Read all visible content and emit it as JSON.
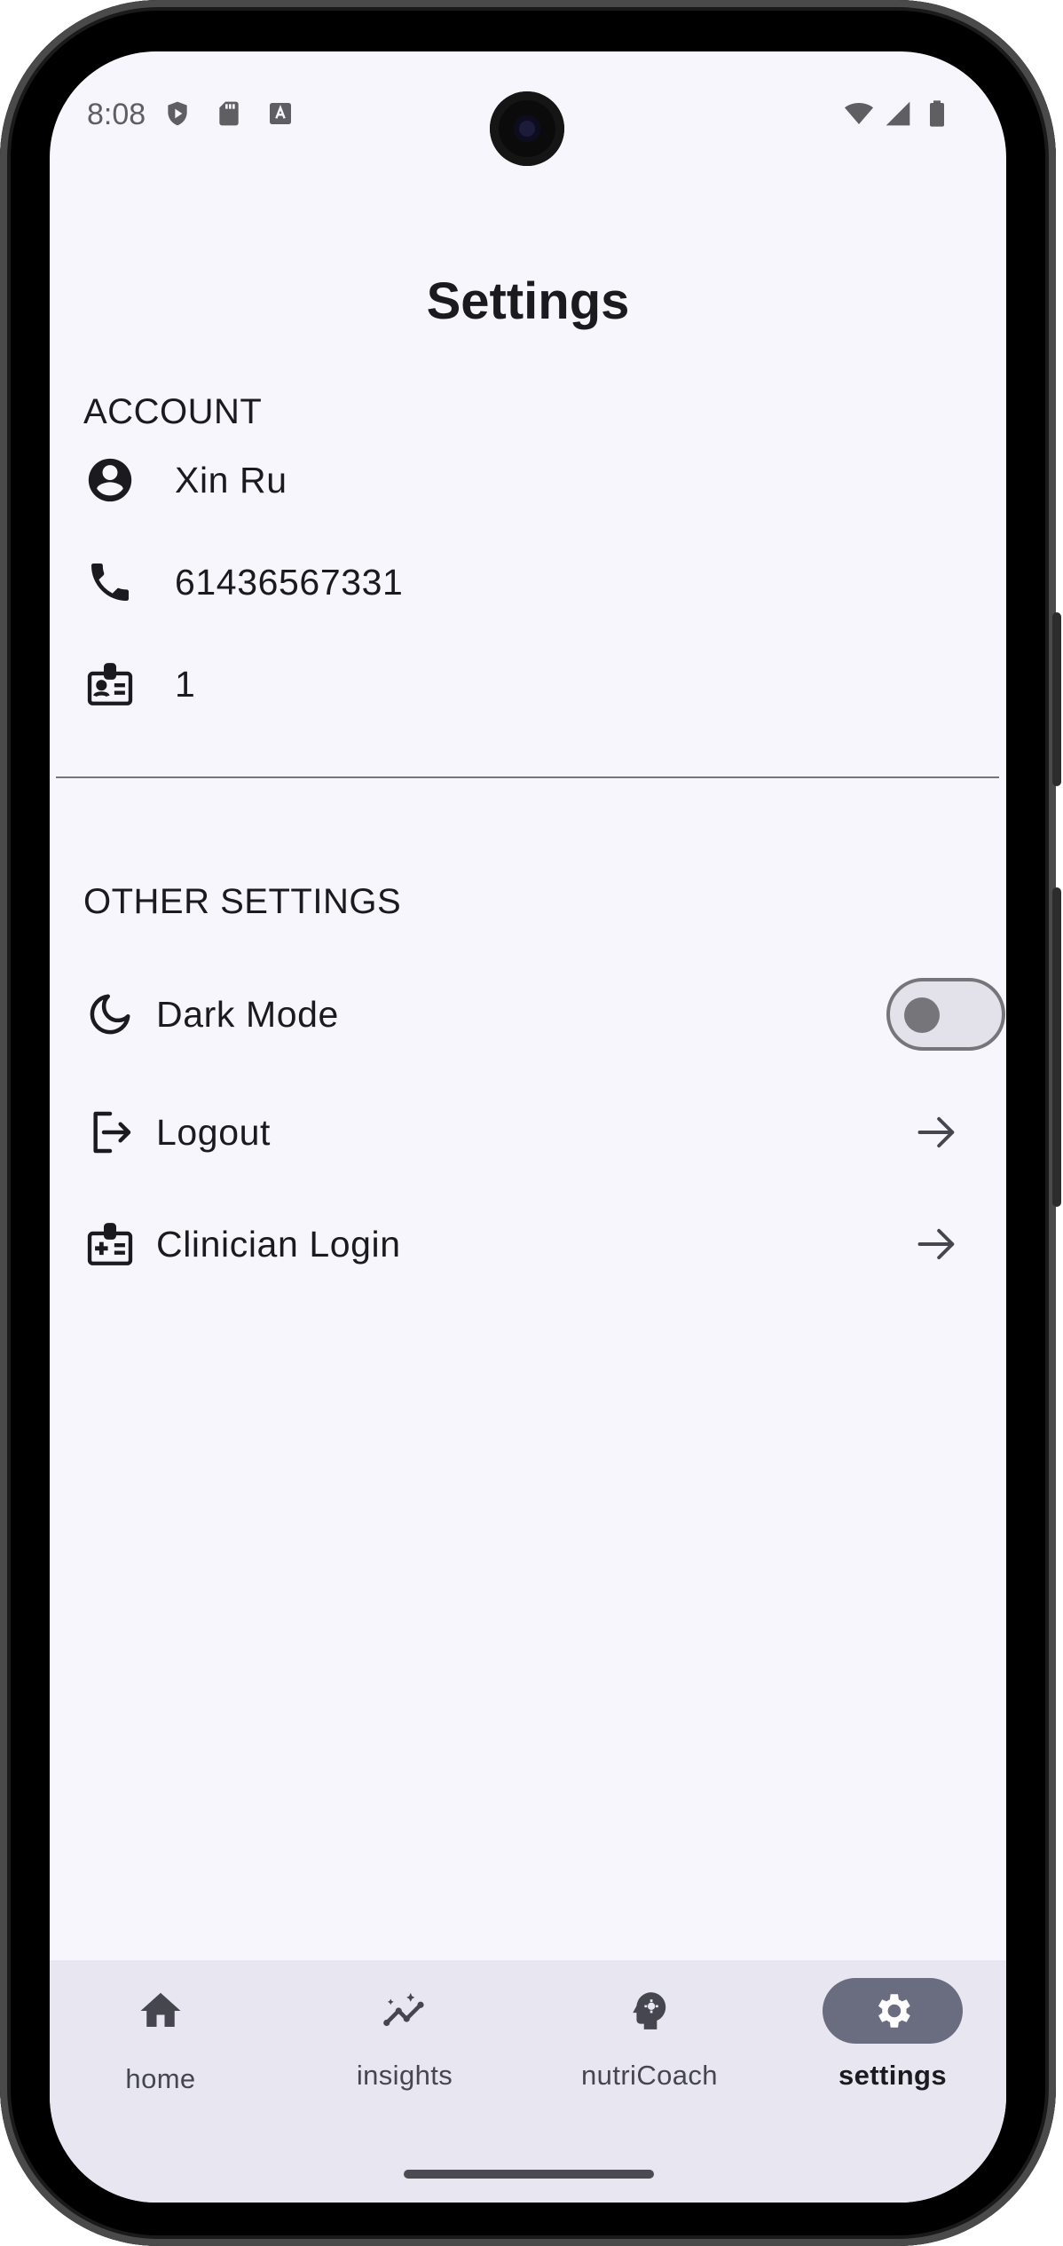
{
  "status_bar": {
    "time": "8:08",
    "left_icons": [
      "play-protect-icon",
      "sd-card-icon",
      "auto-text-icon"
    ],
    "right_icons": [
      "wifi-icon",
      "signal-icon",
      "battery-icon"
    ]
  },
  "header": {
    "title": "Settings"
  },
  "account": {
    "section_title": "ACCOUNT",
    "items": [
      {
        "icon": "account-circle-icon",
        "label": "Xin Ru"
      },
      {
        "icon": "phone-icon",
        "label": "61436567331"
      },
      {
        "icon": "id-badge-icon",
        "label": "1"
      }
    ]
  },
  "other_settings": {
    "section_title": "OTHER SETTINGS",
    "dark_mode": {
      "icon": "moon-icon",
      "label": "Dark Mode",
      "enabled": false
    },
    "logout": {
      "icon": "logout-icon",
      "label": "Logout"
    },
    "clinician_login": {
      "icon": "clinician-badge-icon",
      "label": "Clinician Login"
    }
  },
  "bottom_nav": {
    "items": [
      {
        "icon": "home-icon",
        "label": "home",
        "active": false
      },
      {
        "icon": "insights-icon",
        "label": "insights",
        "active": false
      },
      {
        "icon": "coach-head-icon",
        "label": "nutriCoach",
        "active": false
      },
      {
        "icon": "gear-icon",
        "label": "settings",
        "active": true
      }
    ]
  },
  "colors": {
    "background": "#f7f6fc",
    "nav_background": "#e8e7f1",
    "active_pill": "#6a6d80",
    "divider": "#76757a"
  }
}
